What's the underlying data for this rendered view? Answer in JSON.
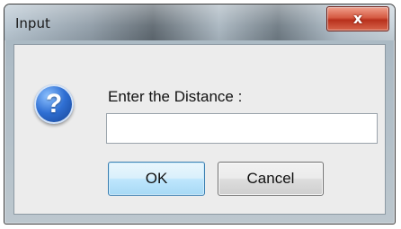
{
  "window": {
    "title": "Input",
    "close_icon": "close-icon",
    "close_glyph": "x"
  },
  "dialog": {
    "icon": "question-icon",
    "icon_glyph": "?",
    "prompt": "Enter the Distance :",
    "input_value": "",
    "ok_label": "OK",
    "cancel_label": "Cancel"
  },
  "colors": {
    "close_button": "#c8402a",
    "ok_button_border": "#3c7fb1",
    "question_icon": "#2f6fd3"
  }
}
